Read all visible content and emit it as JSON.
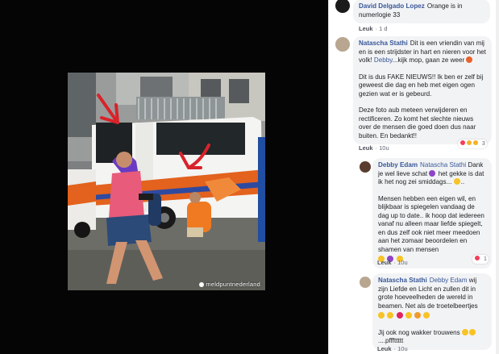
{
  "media": {
    "watermark": "meldpuntnederland"
  },
  "comments": [
    {
      "author": "David Delgado Lopez",
      "text": "Orange is in numerlogie 33",
      "like_label": "Leuk",
      "time": "1 d"
    },
    {
      "author": "Natascha Stathi",
      "text1": "Dit is een vriendin van mij en is een strijdster in hart en nieren voor het volk!",
      "mention": "Debby",
      "text1b": "...kijk mop, gaan ze weer",
      "text2": "Dit is dus FAKE NIEUWS!! Ik ben er zelf bij geweest die dag en heb met eigen ogen gezien wat er is gebeurd.",
      "text3": "Deze foto aub meteen verwijderen en rectificeren. Zo komt het slechte nieuws over de mensen die goed doen dus naar buiten. En bedankt!!",
      "like_label": "Leuk",
      "time": "10u",
      "reaction_count": "3"
    },
    {
      "author": "Debby Edam",
      "mention": "Natascha Stathi",
      "text1": "Dank je wel lieve schat",
      "text1b": "het gekke is dat ik het nog zei smiddags...",
      "text2": "Mensen hebben een eigen wil, en blijkbaar is spiegelen vandaag de dag up to date.. ik hoop dat iedereen vanaf nu alleen maar liefde spiegelt, en dus zelf ook niet meer meedoen aan het zomaar beoordelen en shamen van mensen",
      "like_label": "Leuk",
      "time": "10u",
      "reaction_count": "1"
    },
    {
      "author": "Natascha Stathi",
      "mention": "Debby Edam",
      "text1": "wij zijn Liefde en Licht en zullen dit in grote hoeveelheden de wereld in beamen. Net als de troetelbeertjes",
      "text2": "Jij ook nog wakker trouwens",
      "text2b": "....pfffttttt",
      "like_label": "Leuk",
      "time": "10u"
    }
  ]
}
